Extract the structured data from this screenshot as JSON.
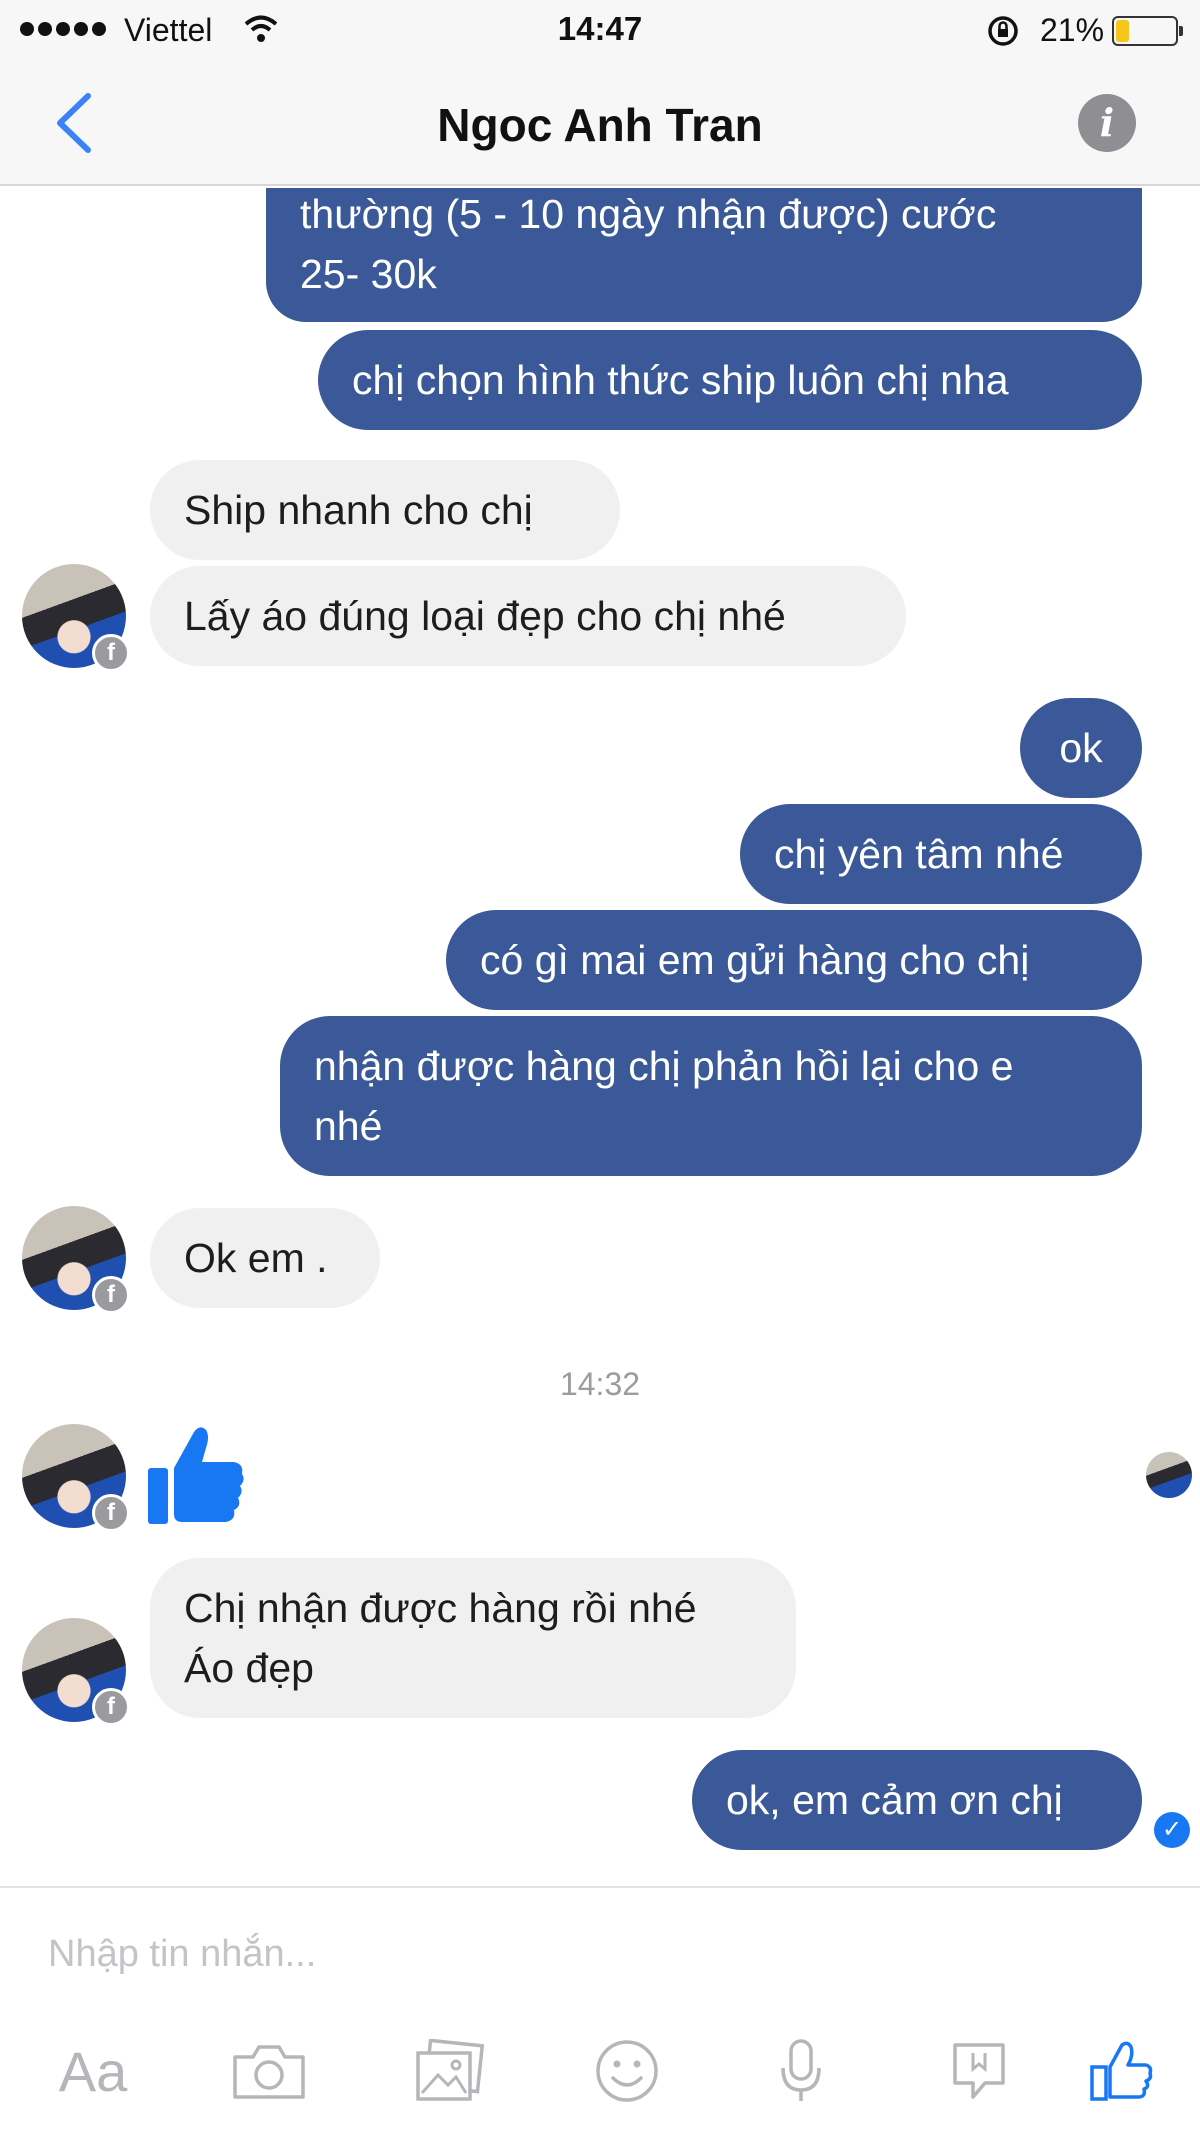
{
  "status_bar": {
    "carrier": "Viettel",
    "time": "14:47",
    "battery_percent": "21%",
    "battery_level": 0.21,
    "signal_dots": 5
  },
  "header": {
    "title": "Ngoc Anh Tran",
    "back_icon": "chevron-left-icon",
    "info_icon": "info-icon",
    "info_glyph": "i"
  },
  "messages": [
    {
      "from": "me",
      "lines": [
        "thường (5 - 10 ngày nhận được) cước",
        "25- 30k"
      ]
    },
    {
      "from": "me",
      "lines": [
        "chị chọn hình thức ship luôn chị nha"
      ]
    },
    {
      "from": "contact",
      "lines": [
        "Ship nhanh cho chị"
      ]
    },
    {
      "from": "contact",
      "lines": [
        "Lấy áo đúng loại đẹp cho chị nhé"
      ]
    },
    {
      "from": "me",
      "lines": [
        "ok"
      ]
    },
    {
      "from": "me",
      "lines": [
        "chị yên tâm nhé"
      ]
    },
    {
      "from": "me",
      "lines": [
        "có gì mai em gửi hàng cho chị"
      ]
    },
    {
      "from": "me",
      "lines": [
        "nhận được hàng chị phản hồi lại cho e",
        "nhé"
      ]
    },
    {
      "from": "contact",
      "lines": [
        "Ok em ."
      ]
    },
    {
      "from": "contact",
      "sticker": "thumbs-up-icon"
    },
    {
      "from": "contact",
      "lines": [
        "Chị nhận được hàng rồi nhé",
        "Áo đẹp"
      ]
    },
    {
      "from": "me",
      "lines": [
        "ok, em cảm ơn chị"
      ]
    }
  ],
  "timestamp_divider": "14:32",
  "avatar_badge": "f",
  "delivered_check": "✓",
  "composer": {
    "placeholder": "Nhập tin nhắn...",
    "text_tool": "Aa",
    "tools": [
      "camera-icon",
      "gallery-icon",
      "emoji-icon",
      "microphone-icon",
      "location-pin-icon",
      "like-icon"
    ]
  },
  "colors": {
    "outgoing_bubble": "#3b5998",
    "incoming_bubble": "#f1f0f0",
    "accent": "#1877f2",
    "battery": "#f5c518"
  }
}
